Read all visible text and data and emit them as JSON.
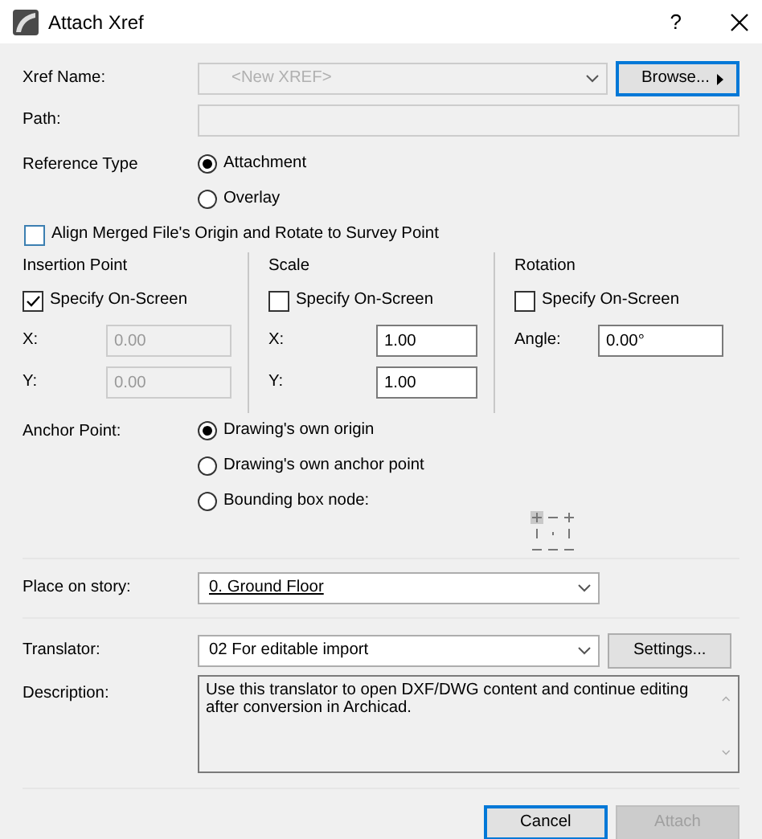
{
  "window": {
    "title": "Attach Xref",
    "help": "?"
  },
  "xref_name": {
    "label": "Xref Name:",
    "placeholder": "<New XREF>",
    "disabled": true
  },
  "browse_button": {
    "label": "Browse...",
    "focused": true
  },
  "path": {
    "label": "Path:"
  },
  "reference_type": {
    "label": "Reference Type",
    "options": [
      {
        "label": "Attachment",
        "selected": true
      },
      {
        "label": "Overlay",
        "selected": false
      }
    ]
  },
  "align_survey": {
    "label": "Align Merged File's Origin and Rotate to Survey Point",
    "checked": false
  },
  "groups": [
    {
      "title": "Insertion Point",
      "specify": {
        "label": "Specify On-Screen",
        "checked": true
      },
      "fields": [
        {
          "label": "X:",
          "value": "0.00",
          "disabled": true
        },
        {
          "label": "Y:",
          "value": "0.00",
          "disabled": true
        }
      ]
    },
    {
      "title": "Scale",
      "specify": {
        "label": "Specify On-Screen",
        "checked": false
      },
      "fields": [
        {
          "label": "X:",
          "value": "1.00",
          "disabled": false
        },
        {
          "label": "Y:",
          "value": "1.00",
          "disabled": false
        }
      ]
    },
    {
      "title": "Rotation",
      "specify": {
        "label": "Specify On-Screen",
        "checked": false
      },
      "fields": [
        {
          "label": "Angle:",
          "value": "0.00°",
          "disabled": false
        }
      ]
    }
  ],
  "anchor_point": {
    "label": "Anchor Point:",
    "options": [
      {
        "label": "Drawing's own origin",
        "selected": true
      },
      {
        "label": "Drawing's own anchor point",
        "selected": false
      },
      {
        "label": "Bounding box node:",
        "selected": false
      }
    ]
  },
  "story": {
    "label": "Place on story:",
    "value": "0. Ground Floor"
  },
  "translator": {
    "label": "Translator:",
    "value": "02 For editable import",
    "settings": "Settings..."
  },
  "description": {
    "label": "Description:",
    "text": "Use this translator to open DXF/DWG content and continue editing after conversion in Archicad."
  },
  "buttons": [
    {
      "label": "Cancel",
      "disabled": false,
      "focused": true
    },
    {
      "label": "Attach",
      "disabled": true,
      "focused": false
    }
  ]
}
